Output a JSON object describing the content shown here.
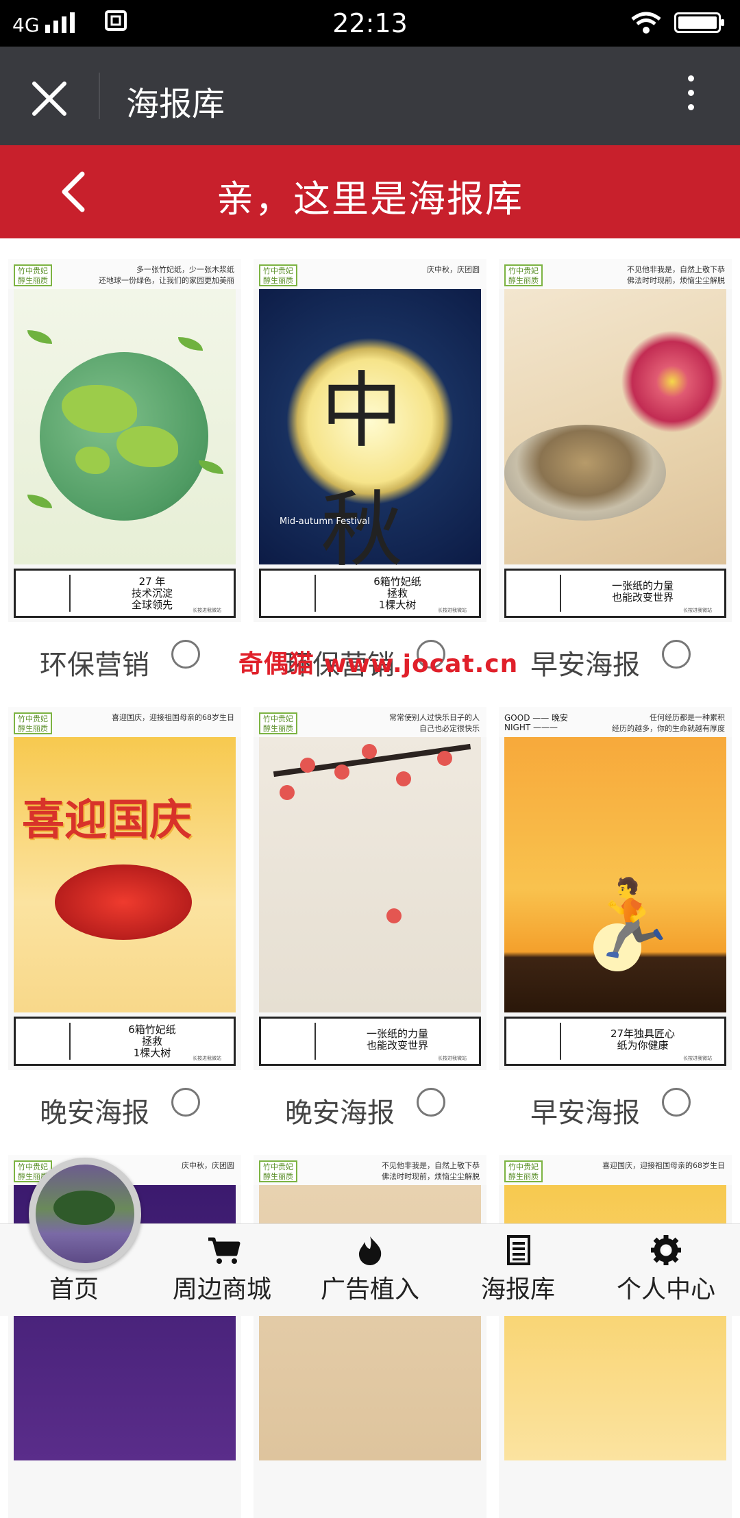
{
  "status_bar": {
    "network": "4G",
    "sim_icon": "sim-card-icon",
    "time": "22:13"
  },
  "title_bar": {
    "title": "海报库",
    "close_icon": "close-icon",
    "more_icon": "more-vertical-icon"
  },
  "header": {
    "title": "亲，这里是海报库",
    "back_icon": "chevron-left-icon"
  },
  "brand_color": "#c8202c",
  "posters": [
    {
      "label": "环保营销",
      "logo": "竹中贵妃\n醇生丽质",
      "tagline": "多一张竹妃纸，少一张木浆纸\n还地球一份绿色，让我们的家园更加美丽",
      "message": "27 年\n技术沉淀\n全球领先",
      "art": "earth"
    },
    {
      "label": "环保营销",
      "logo": "竹中贵妃\n醇生丽质",
      "tagline": "庆中秋，庆团圆",
      "message": "6箱竹妃纸\n拯救\n1棵大树",
      "art": "moon",
      "art_text": "Mid-autumn Festival"
    },
    {
      "label": "早安海报",
      "logo": "竹中贵妃\n醇生丽质",
      "tagline": "不见他非我是，自然上敬下恭\n佛法时时现前，烦恼尘尘解脱",
      "message": "一张纸的力量\n也能改变世界",
      "art": "tea"
    },
    {
      "label": "晚安海报",
      "logo": "竹中贵妃\n醇生丽质",
      "tagline": "喜迎国庆，迎接祖国母亲的68岁生日",
      "message": "6箱竹妃纸\n拯救\n1棵大树",
      "art": "national",
      "art_text": "喜迎国庆"
    },
    {
      "label": "晚安海报",
      "logo": "竹中贵妃\n醇生丽质",
      "tagline": "常常使别人过快乐日子的人\n自己也必定很快乐",
      "message": "一张纸的力量\n也能改变世界",
      "art": "plum"
    },
    {
      "label": "早安海报",
      "logo": "GOOD —— 晚安\nNIGHT ———",
      "tagline": "任何经历都是一种累积\n经历的越多，你的生命就越有厚度",
      "message": "27年独具匠心\n纸为你健康",
      "art": "sunset"
    }
  ],
  "partial_posters": [
    {
      "logo": "竹中贵妃\n醇生丽质",
      "tagline": "庆中秋，庆团圆",
      "art": "lav"
    },
    {
      "logo": "竹中贵妃\n醇生丽质",
      "tagline": "不见他非我是，自然上敬下恭\n佛法时时现前，烦恼尘尘解脱",
      "art": "beige"
    },
    {
      "logo": "竹中贵妃\n醇生丽质",
      "tagline": "喜迎国庆，迎接祖国母亲的68岁生日",
      "art": "gold"
    }
  ],
  "poster_footer": "长按进我微站",
  "watermark": "奇偶猫 www.jocat.cn",
  "bottom_nav": [
    {
      "label": "首页",
      "icon": "home-avatar-icon"
    },
    {
      "label": "周边商城",
      "icon": "cart-icon"
    },
    {
      "label": "广告植入",
      "icon": "flame-icon"
    },
    {
      "label": "海报库",
      "icon": "list-doc-icon"
    },
    {
      "label": "个人中心",
      "icon": "gear-icon"
    }
  ]
}
